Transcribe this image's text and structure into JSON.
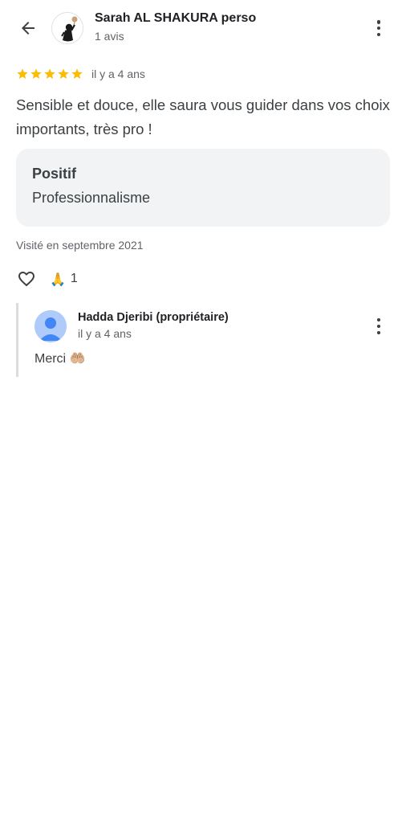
{
  "header": {
    "back_icon": "arrow-back-icon",
    "reviewer_name": "Sarah AL SHAKURA perso",
    "review_count": "1 avis",
    "menu_icon": "more-vert-icon"
  },
  "review": {
    "rating": 5,
    "rating_max": 5,
    "star_color": "#fbbc04",
    "time_ago": "il y a 4 ans",
    "text": "Sensible et douce, elle saura vous guider dans vos choix importants, très pro !",
    "attribute": {
      "title": "Positif",
      "value": "Professionnalisme"
    },
    "visited": "Visité en septembre 2021",
    "like_icon": "heart-outline-icon",
    "reaction_emoji": "🙏",
    "reaction_count": "1"
  },
  "owner_reply": {
    "name": "Hadda Djeribi (propriétaire)",
    "time_ago": "il y a 4 ans",
    "text": "Merci",
    "emoji": "🤲🏼",
    "avatar_icon": "default-profile-icon",
    "menu_icon": "more-vert-icon"
  },
  "colors": {
    "text_primary": "#202124",
    "text_secondary": "#5f6368",
    "card_background": "#f1f3f4",
    "reply_border": "#dadce0",
    "owner_avatar_bg": "#aecbfa",
    "owner_avatar_fg": "#4285f4"
  }
}
